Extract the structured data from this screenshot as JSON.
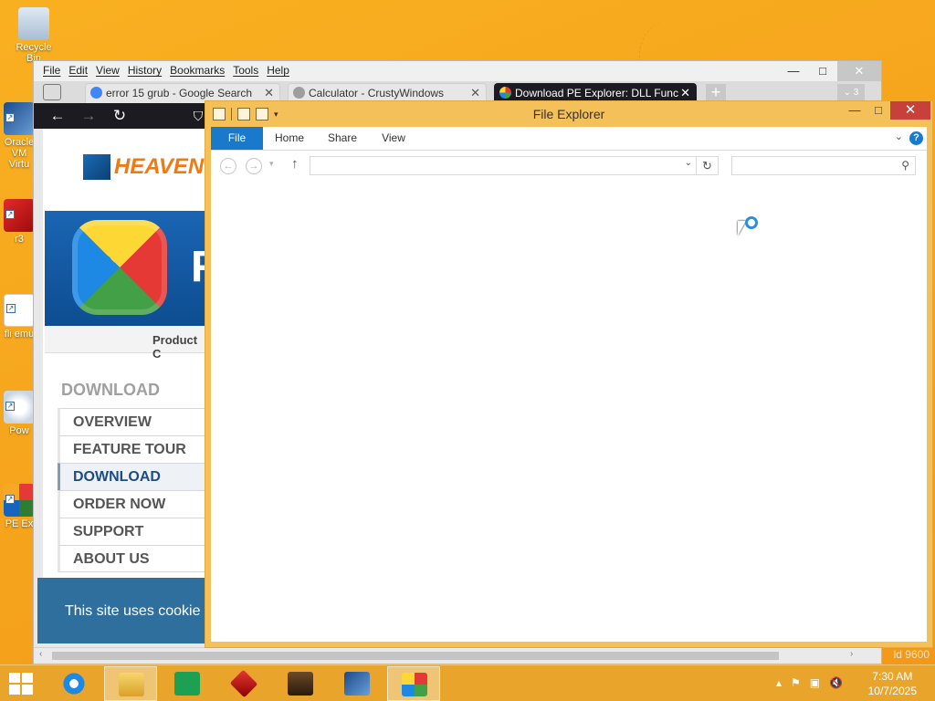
{
  "desktop": {
    "icons": [
      {
        "label": "Recycle Bin"
      },
      {
        "label": "Oracle VM Virtu"
      },
      {
        "label": "r3"
      },
      {
        "label": "fli emu"
      },
      {
        "label": "Pow"
      },
      {
        "label": "PE Ex"
      }
    ],
    "watermark": "ld 9600"
  },
  "firefox": {
    "menu": [
      "File",
      "Edit",
      "View",
      "History",
      "Bookmarks",
      "Tools",
      "Help"
    ],
    "tabs": [
      {
        "title": "error 15 grub - Google Search",
        "favicon_color": "#4285f4"
      },
      {
        "title": "Calculator - CrustyWindows",
        "favicon_color": "#9e9e9e"
      },
      {
        "title": "Download PE Explorer: DLL Func",
        "favicon_color": "#e53935"
      }
    ],
    "tab_count": "3",
    "page": {
      "logo": "HEAVEN",
      "banner_letter": "F",
      "product_label": "Product C",
      "section_heading": "DOWNLOAD",
      "menu": [
        "OVERVIEW",
        "FEATURE TOUR",
        "DOWNLOAD",
        "ORDER NOW",
        "SUPPORT",
        "ABOUT US"
      ],
      "active_menu": "DOWNLOAD"
    },
    "cookie_banner": "This site uses cookie"
  },
  "explorer": {
    "title": "File Explorer",
    "ribbon_tabs": [
      "File",
      "Home",
      "Share",
      "View"
    ],
    "address_value": "",
    "search_placeholder": ""
  },
  "taskbar": {
    "apps": [
      "Internet Explorer",
      "File Explorer",
      "Store",
      "r3",
      "Character",
      "VirtualBox",
      "PE Explorer"
    ],
    "time": "7:30 AM",
    "date": "10/7/2025"
  },
  "colors": {
    "accent_blue": "#1979ca",
    "wallpaper": "#f5a623",
    "explorer_frame": "#f3c05a"
  }
}
